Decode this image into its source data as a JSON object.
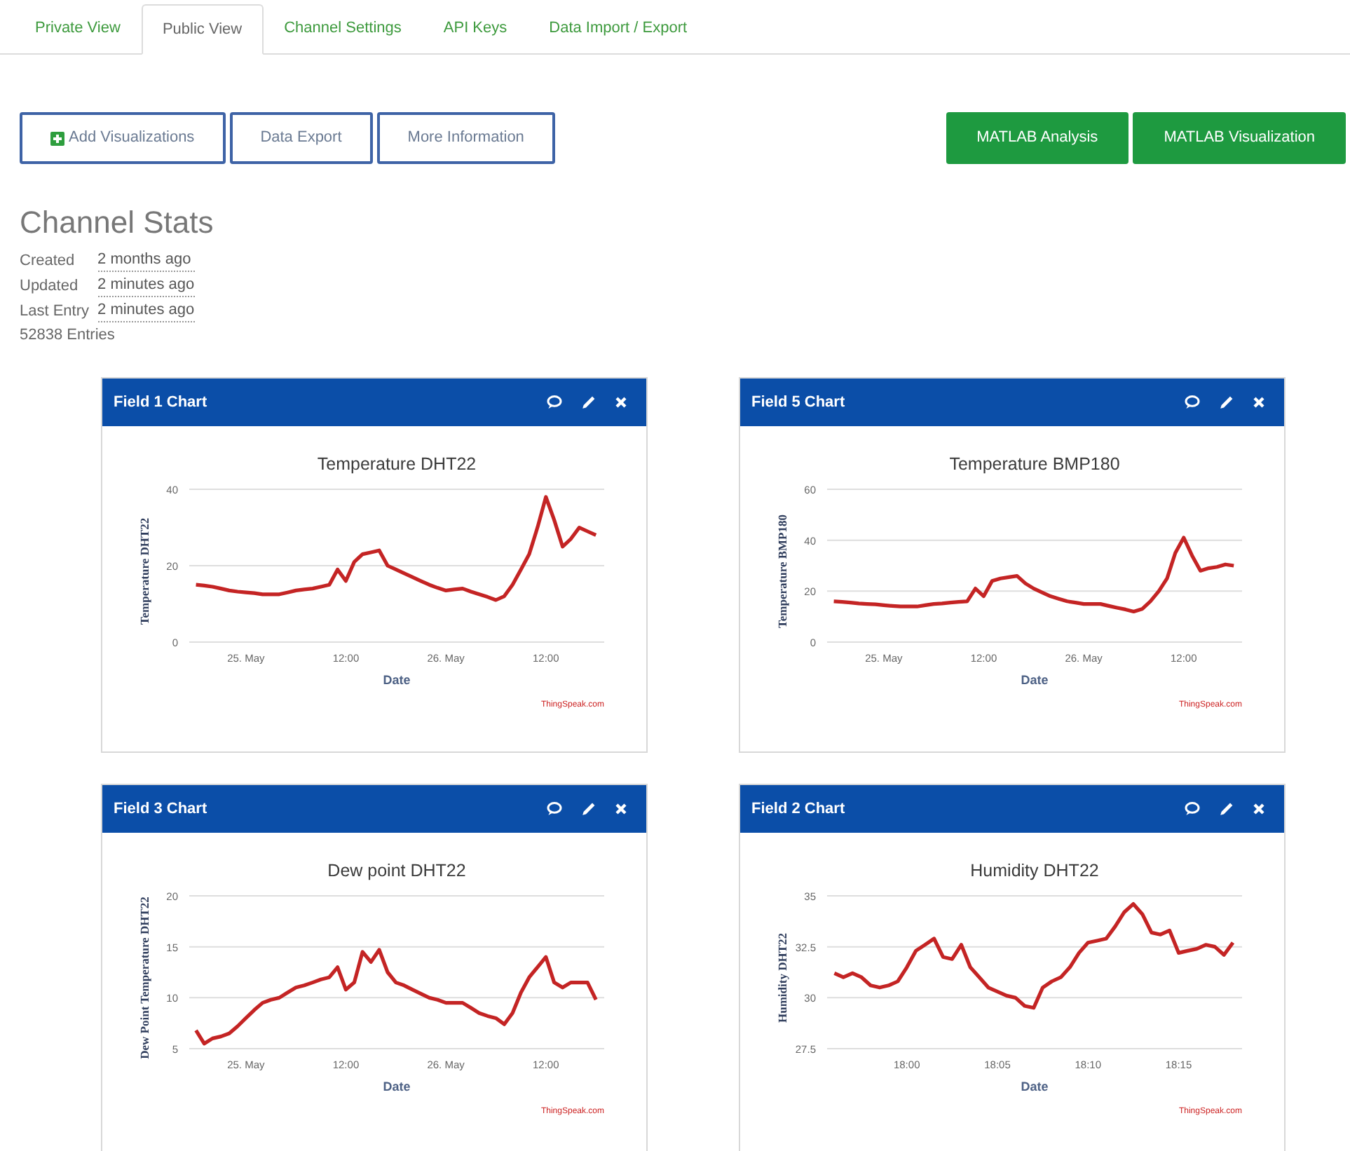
{
  "tabs": [
    {
      "label": "Private View",
      "selected": false
    },
    {
      "label": "Public View",
      "selected": true
    },
    {
      "label": "Channel Settings",
      "selected": false
    },
    {
      "label": "API Keys",
      "selected": false
    },
    {
      "label": "Data Import / Export",
      "selected": false
    }
  ],
  "actions": [
    {
      "label": "Add Visualizations",
      "kind": "add"
    },
    {
      "label": "Data Export",
      "kind": "plain"
    },
    {
      "label": "More Information",
      "kind": "plain"
    }
  ],
  "matlab_buttons": [
    "MATLAB Analysis",
    "MATLAB Visualization"
  ],
  "channel_stats": {
    "title": "Channel Stats",
    "rows": [
      {
        "label": "Created",
        "value": "2 months ago"
      },
      {
        "label": "Updated",
        "value": "2 minutes ago"
      },
      {
        "label": "Last Entry",
        "value": "2 minutes ago"
      }
    ],
    "entries": "52838 Entries"
  },
  "widgets": [
    {
      "title": "Field 1 Chart",
      "credit": "ThingSpeak.com",
      "chart_data": {
        "type": "line",
        "title": "Temperature DHT22",
        "xlabel": "Date",
        "ylabel": "Temperature DHT22",
        "ylim": [
          0,
          40
        ],
        "yticks": [
          0,
          20,
          40
        ],
        "categories": [
          null,
          null,
          null,
          null,
          null,
          null,
          "25. May",
          null,
          null,
          null,
          null,
          null,
          null,
          null,
          null,
          null,
          null,
          null,
          "12:00",
          null,
          null,
          null,
          null,
          null,
          null,
          null,
          null,
          null,
          null,
          null,
          "26. May",
          null,
          null,
          null,
          null,
          null,
          null,
          null,
          null,
          null,
          null,
          null,
          "12:00",
          null,
          null,
          null,
          null,
          null,
          null
        ],
        "series": [
          {
            "color": "#c42424",
            "values": [
              15,
              14.8,
              14.5,
              14,
              13.5,
              13.2,
              13,
              12.8,
              12.5,
              12.5,
              12.5,
              13,
              13.5,
              13.8,
              14,
              14.5,
              15,
              19,
              16,
              21,
              23,
              23.5,
              24,
              20,
              19,
              18,
              17,
              16,
              15,
              14.2,
              13.5,
              13.8,
              14,
              13.2,
              12.5,
              11.8,
              11,
              12,
              15,
              19,
              23,
              30,
              38,
              32,
              25,
              27,
              30,
              29,
              28
            ]
          }
        ]
      }
    },
    {
      "title": "Field 5 Chart",
      "credit": "ThingSpeak.com",
      "chart_data": {
        "type": "line",
        "title": "Temperature BMP180",
        "xlabel": "Date",
        "ylabel": "Temperature BMP180",
        "ylim": [
          0,
          60
        ],
        "yticks": [
          0,
          20,
          40,
          60
        ],
        "categories": [
          null,
          null,
          null,
          null,
          null,
          null,
          "25. May",
          null,
          null,
          null,
          null,
          null,
          null,
          null,
          null,
          null,
          null,
          null,
          "12:00",
          null,
          null,
          null,
          null,
          null,
          null,
          null,
          null,
          null,
          null,
          null,
          "26. May",
          null,
          null,
          null,
          null,
          null,
          null,
          null,
          null,
          null,
          null,
          null,
          "12:00",
          null,
          null,
          null,
          null,
          null,
          null
        ],
        "series": [
          {
            "color": "#c42424",
            "values": [
              16,
              15.8,
              15.5,
              15.2,
              15,
              14.8,
              14.5,
              14.2,
              14,
              14,
              14,
              14.5,
              15,
              15.2,
              15.5,
              15.8,
              16,
              21,
              18,
              24,
              25,
              25.5,
              26,
              23,
              21,
              19.5,
              18,
              17,
              16,
              15.5,
              15,
              15,
              15,
              14.2,
              13.5,
              12.8,
              12,
              13,
              16,
              20,
              25,
              35,
              41,
              34,
              28,
              29,
              29.5,
              30.5,
              30
            ]
          }
        ]
      }
    },
    {
      "title": "Field 3 Chart",
      "credit": "ThingSpeak.com",
      "chart_data": {
        "type": "line",
        "title": "Dew point DHT22",
        "xlabel": "Date",
        "ylabel": "Dew Point Temperature DHT22",
        "ylim": [
          5,
          20
        ],
        "yticks": [
          5,
          10,
          15,
          20
        ],
        "categories": [
          null,
          null,
          null,
          null,
          null,
          null,
          "25. May",
          null,
          null,
          null,
          null,
          null,
          null,
          null,
          null,
          null,
          null,
          null,
          "12:00",
          null,
          null,
          null,
          null,
          null,
          null,
          null,
          null,
          null,
          null,
          null,
          "26. May",
          null,
          null,
          null,
          null,
          null,
          null,
          null,
          null,
          null,
          null,
          null,
          "12:00",
          null,
          null,
          null,
          null,
          null,
          null
        ],
        "series": [
          {
            "color": "#c42424",
            "values": [
              6.8,
              5.5,
              6,
              6.2,
              6.5,
              7.2,
              8,
              8.8,
              9.5,
              9.8,
              10,
              10.5,
              11,
              11.2,
              11.5,
              11.8,
              12,
              13,
              10.8,
              11.5,
              14.5,
              13.5,
              14.7,
              12.5,
              11.5,
              11.2,
              10.8,
              10.4,
              10,
              9.8,
              9.5,
              9.5,
              9.5,
              9,
              8.5,
              8.2,
              8,
              7.4,
              8.5,
              10.5,
              12,
              13,
              14,
              11.5,
              11,
              11.5,
              11.5,
              11.5,
              9.8
            ]
          }
        ]
      }
    },
    {
      "title": "Field 2 Chart",
      "credit": "ThingSpeak.com",
      "chart_data": {
        "type": "line",
        "title": "Humidity DHT22",
        "xlabel": "Date",
        "ylabel": "Humidity DHT22",
        "ylim": [
          27.5,
          35
        ],
        "yticks": [
          27.5,
          30,
          32.5,
          35
        ],
        "categories": [
          null,
          null,
          null,
          null,
          null,
          null,
          null,
          null,
          "18:00",
          null,
          null,
          null,
          null,
          null,
          null,
          null,
          null,
          null,
          "18:05",
          null,
          null,
          null,
          null,
          null,
          null,
          null,
          null,
          null,
          "18:10",
          null,
          null,
          null,
          null,
          null,
          null,
          null,
          null,
          null,
          "18:15",
          null,
          null,
          null,
          null,
          null,
          null
        ],
        "series": [
          {
            "color": "#c42424",
            "values": [
              31.2,
              31,
              31.2,
              31,
              30.6,
              30.5,
              30.6,
              30.8,
              31.5,
              32.3,
              32.6,
              32.9,
              32,
              31.9,
              32.6,
              31.5,
              31,
              30.5,
              30.3,
              30.1,
              30,
              29.6,
              29.5,
              30.5,
              30.8,
              31,
              31.5,
              32.2,
              32.7,
              32.8,
              32.9,
              33.5,
              34.2,
              34.6,
              34.1,
              33.2,
              33.1,
              33.3,
              32.2,
              32.3,
              32.4,
              32.6,
              32.5,
              32.1,
              32.7
            ]
          }
        ]
      }
    }
  ]
}
